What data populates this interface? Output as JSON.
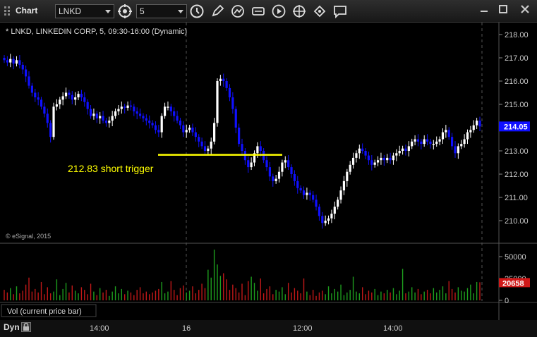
{
  "window": {
    "title": "Chart",
    "symbol": "LNKD",
    "interval": "5",
    "toolbar_icons": [
      "link-icon",
      "clock-icon",
      "pencil-icon",
      "draw-arc-icon",
      "study-icon",
      "play-icon",
      "crosshair-icon",
      "speech-bubble-icon"
    ],
    "window_controls": [
      "minimize-icon",
      "maximize-icon",
      "close-icon"
    ]
  },
  "chart": {
    "header": "* LNKD, LINKEDIN CORP, 5, 09:30-16:00 (Dynamic)",
    "watermark": "© eSignal, 2015",
    "annotation": "212.83 short trigger",
    "current_price_label": "214.05",
    "volume_label": "Vol (current price bar)",
    "volume_current_label": "20658",
    "bottom_label": "Dyn",
    "colors": {
      "up": "#ffffff",
      "down": "#1010ff",
      "trigger_line": "#ffff00",
      "vol_up": "#1e9e1e",
      "vol_down": "#c01818"
    }
  },
  "chart_data": {
    "type": "candlestick",
    "price_axis": {
      "ticks": [
        "218.00",
        "217.00",
        "216.00",
        "215.00",
        "214.00",
        "213.00",
        "212.00",
        "211.00",
        "210.00"
      ],
      "ylim": [
        209.25,
        218.2
      ]
    },
    "volume_axis": {
      "ticks": [
        "50000",
        "25000",
        "0"
      ],
      "ylim": [
        0,
        60000
      ]
    },
    "x_ticks": [
      "14:00",
      "16",
      "12:00",
      "14:00"
    ],
    "trigger_level": 212.83,
    "current_price": 214.05,
    "close_series": [
      216.9,
      216.8,
      216.95,
      216.75,
      216.9,
      216.7,
      216.5,
      216.2,
      215.8,
      215.5,
      215.3,
      215.2,
      214.9,
      214.6,
      214.2,
      213.6,
      214.9,
      215.0,
      215.2,
      215.35,
      215.5,
      215.4,
      215.2,
      215.3,
      215.45,
      215.3,
      215.1,
      214.8,
      214.5,
      214.6,
      214.4,
      214.5,
      214.3,
      214.2,
      214.3,
      214.5,
      214.7,
      214.8,
      214.9,
      214.85,
      214.95,
      214.9,
      214.7,
      214.6,
      214.5,
      214.4,
      214.3,
      214.2,
      214.1,
      213.9,
      213.8,
      214.5,
      214.9,
      214.9,
      214.7,
      214.5,
      214.3,
      214.1,
      213.8,
      213.9,
      214.0,
      213.8,
      213.6,
      213.4,
      213.2,
      213.0,
      213.1,
      213.4,
      214.2,
      216.0,
      216.1,
      216.0,
      215.7,
      215.3,
      214.8,
      214.0,
      213.3,
      213.0,
      212.6,
      212.3,
      212.5,
      212.9,
      213.2,
      213.0,
      212.6,
      212.3,
      211.9,
      211.7,
      211.8,
      212.1,
      212.5,
      212.6,
      212.3,
      212.0,
      211.7,
      211.4,
      211.3,
      211.1,
      211.2,
      211.1,
      210.9,
      210.6,
      210.2,
      209.9,
      210.0,
      210.1,
      210.3,
      210.6,
      210.9,
      211.3,
      211.7,
      212.1,
      212.4,
      212.7,
      212.9,
      213.1,
      213.0,
      212.8,
      212.6,
      212.4,
      212.5,
      212.6,
      212.7,
      212.6,
      212.7,
      212.6,
      212.8,
      212.9,
      213.0,
      213.1,
      213.0,
      213.2,
      213.4,
      213.5,
      213.4,
      213.3,
      213.5,
      213.4,
      213.3,
      213.3,
      213.4,
      213.5,
      213.8,
      213.9,
      213.6,
      213.2,
      212.9,
      213.2,
      213.3,
      213.5,
      213.8,
      213.9,
      214.1,
      214.3,
      214.05
    ],
    "volume_series": [
      12000,
      9000,
      14000,
      7000,
      16000,
      8000,
      11000,
      18000,
      26000,
      10000,
      13000,
      9000,
      21000,
      7000,
      15000,
      8000,
      10000,
      24000,
      6000,
      13000,
      20000,
      9000,
      17000,
      11000,
      8000,
      15000,
      12000,
      7000,
      19000,
      10000,
      6000,
      14000,
      9000,
      12000,
      5000,
      10000,
      16000,
      8000,
      13000,
      7000,
      11000,
      9000,
      6000,
      12000,
      15000,
      8000,
      10000,
      7000,
      9000,
      11000,
      13000,
      21000,
      8000,
      10000,
      22000,
      12000,
      6000,
      14000,
      17000,
      9000,
      11000,
      16000,
      8000,
      12000,
      19000,
      14000,
      35000,
      26000,
      58000,
      41000,
      28000,
      31000,
      24000,
      12000,
      18000,
      14000,
      9000,
      19000,
      6000,
      22000,
      27000,
      20000,
      11000,
      25000,
      8000,
      13000,
      16000,
      7000,
      12000,
      10000,
      15000,
      7000,
      20000,
      9000,
      14000,
      11000,
      8000,
      25000,
      10000,
      6000,
      12000,
      5000,
      9000,
      11000,
      7000,
      16000,
      8000,
      13000,
      10000,
      18000,
      6000,
      9000,
      12000,
      27000,
      10000,
      8000,
      15000,
      7000,
      11000,
      9000,
      13000,
      6000,
      10000,
      8000,
      12000,
      9000,
      14000,
      7000,
      11000,
      36000,
      8000,
      10000,
      15000,
      9000,
      13000,
      7000,
      10000,
      12000,
      8000,
      14000,
      9000,
      12000,
      16000,
      8000,
      22000,
      13000,
      9000,
      15000,
      11000,
      10000,
      14000,
      18000,
      8000,
      21000,
      20658
    ]
  }
}
